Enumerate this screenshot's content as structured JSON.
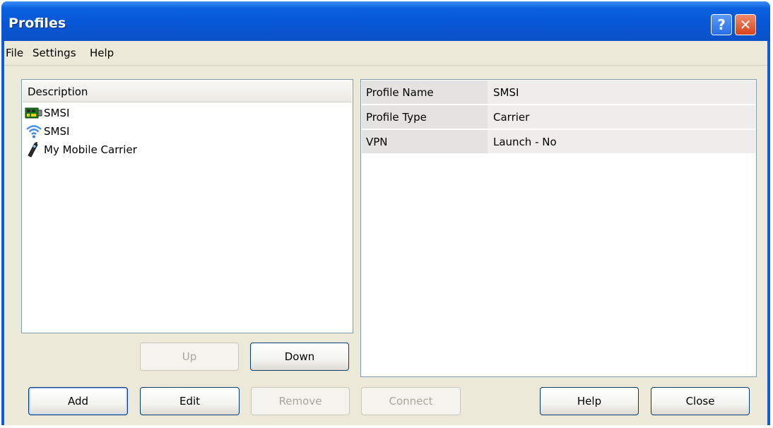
{
  "window": {
    "title": "Profiles"
  },
  "menu": [
    "File",
    "Settings",
    "Help"
  ],
  "list": {
    "header": "Description",
    "items": [
      {
        "label": "SMSI",
        "icon": "network-card-icon"
      },
      {
        "label": "SMSI",
        "icon": "wifi-icon"
      },
      {
        "label": "My Mobile Carrier",
        "icon": "mobile-phone-icon"
      }
    ]
  },
  "properties": [
    {
      "name": "Profile Name",
      "value": "SMSI"
    },
    {
      "name": "Profile Type",
      "value": "Carrier"
    },
    {
      "name": "VPN",
      "value": "Launch - No"
    }
  ],
  "buttons": {
    "up": "Up",
    "down": "Down",
    "add": "Add",
    "edit": "Edit",
    "remove": "Remove",
    "connect": "Connect",
    "help": "Help",
    "close": "Close"
  },
  "titlebar_buttons": {
    "help": "?",
    "close": "✕"
  },
  "colors": {
    "titlebar": "#0856d6",
    "dialog_bg": "#ece9d8",
    "button_border": "#003c74"
  }
}
